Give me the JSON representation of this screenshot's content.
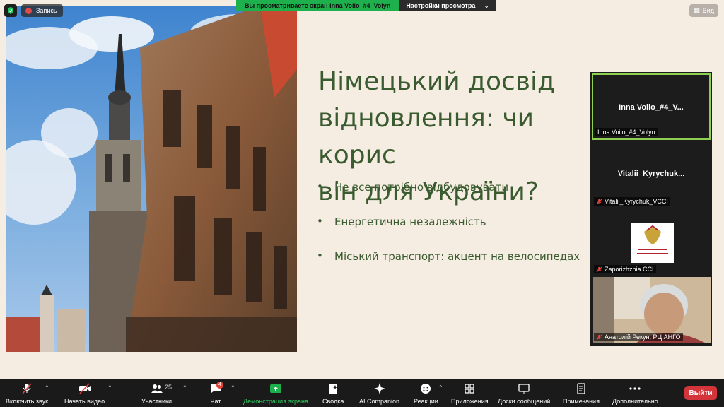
{
  "topbar": {
    "recording_label": "Запись",
    "share_banner_text": "Вы просматриваете экран Inna Voilo_#4_Volyn",
    "view_options_label": "Настройки просмотра",
    "view_button_label": "Вид"
  },
  "slide": {
    "title": "Німецький досвід\nвідновлення: чи корис\nвін для України?",
    "bullets": [
      "Не все потрібно відбудовувати",
      "Енергетична незалежність",
      "Міський транспорт: акцент на велосипедах"
    ]
  },
  "participants": [
    {
      "display_name": "Inna  Voilo_#4_V...",
      "label": "Inna Voilo_#4_Volyn",
      "active": true,
      "muted": false
    },
    {
      "display_name": "Vitalii_Kyrychuk...",
      "label": "Vitalii_Kyrychuk_VCCI",
      "active": false,
      "muted": true
    },
    {
      "display_name": "",
      "label": "Zaporizhzhia CCI",
      "active": false,
      "muted": true
    },
    {
      "display_name": "",
      "label": "Анатолій Рекун, РЦ АНГО",
      "active": false,
      "muted": true
    }
  ],
  "toolbar": {
    "mute_label": "Включить звук",
    "video_label": "Начать видео",
    "participants_label": "Участники",
    "participants_count": "25",
    "chat_label": "Чат",
    "chat_badge": "4",
    "share_label": "Демонстрация экрана",
    "summary_label": "Сводка",
    "ai_label": "AI Companion",
    "reactions_label": "Реакции",
    "apps_label": "Приложения",
    "whiteboards_label": "Доски сообщений",
    "notes_label": "Примечания",
    "more_label": "Дополнительно",
    "leave_label": "Выйти"
  },
  "colors": {
    "slide_bg": "#f5ede2",
    "title_green": "#3a5a2f",
    "share_green": "#1fb04e",
    "leave_red": "#d3353a",
    "active_border": "#8fd052"
  }
}
